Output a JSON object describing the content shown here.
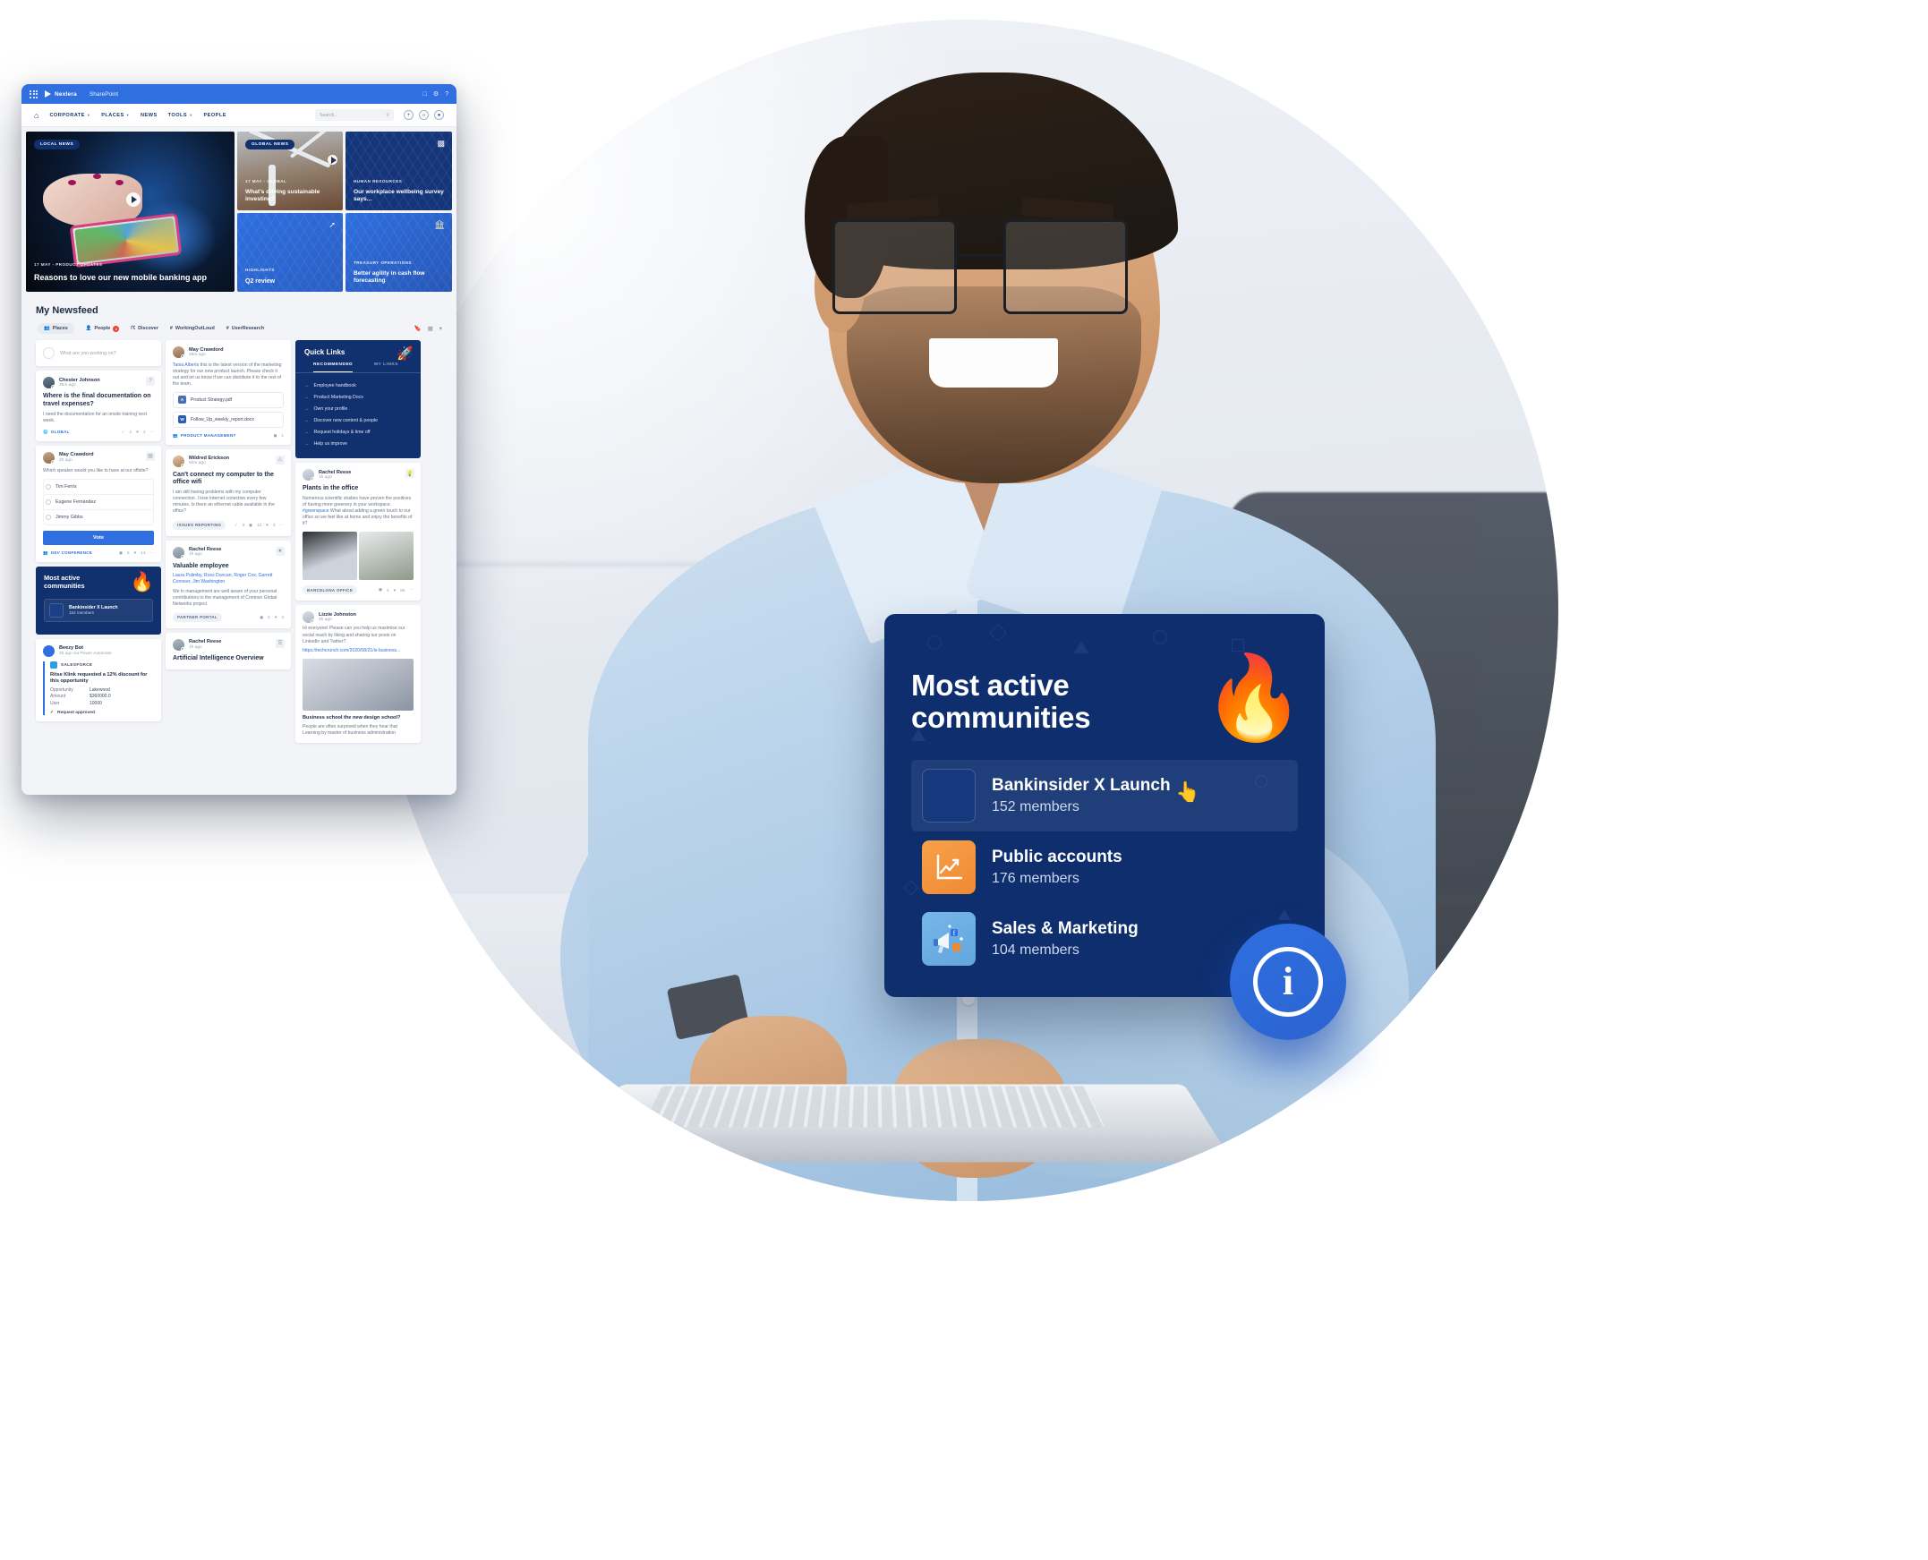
{
  "window": {
    "topbar": {
      "brand": "Nexlera",
      "app": "SharePoint",
      "waffle_icon": "app-launcher-icon",
      "actions": [
        "minimize-icon",
        "gear-icon",
        "help-icon"
      ]
    },
    "nav": {
      "home_icon": "home-icon",
      "items": [
        {
          "label": "CORPORATE",
          "caret": true
        },
        {
          "label": "PLACES",
          "caret": true
        },
        {
          "label": "NEWS",
          "caret": false
        },
        {
          "label": "TOOLS",
          "caret": true
        },
        {
          "label": "PEOPLE",
          "caret": false
        }
      ],
      "search_placeholder": "Search..",
      "search_icon": "search-icon",
      "icons": [
        "plus-icon",
        "bell-icon",
        "account-icon"
      ]
    }
  },
  "hero": {
    "local": {
      "badge": "LOCAL NEWS",
      "meta": "17 MAY - PRODUCT UPDATES",
      "title": "Reasons to love our new mobile banking app",
      "play_icon": "play-icon"
    },
    "global": {
      "badge": "GLOBAL NEWS",
      "meta": "17 MAY -  GLOBAL",
      "title": "What's driving sustainable investing?",
      "play_icon": "play-icon"
    },
    "hr": {
      "category": "HUMAN RESOURCES",
      "title": "Our workplace wellbeing survey says...",
      "icon": "bar-chart-icon"
    },
    "q2": {
      "category": "HIGHLIGHTS",
      "title": "Q2 review",
      "icon": "external-link-icon"
    },
    "treasury": {
      "category": "TREASURY OPERATIONS",
      "title": "Better agility in cash flow forecasting",
      "icon": "bank-icon"
    }
  },
  "newsfeed": {
    "title": "My Newsfeed",
    "filters": [
      {
        "label": "Places",
        "icon": "places-icon",
        "active": true,
        "badge": ""
      },
      {
        "label": "People",
        "icon": "people-icon",
        "active": false,
        "badge": "2"
      },
      {
        "label": "Discover",
        "icon": "discover-icon",
        "active": false,
        "badge": ""
      },
      {
        "label": "WorkingOutLoud",
        "icon": "hash-icon",
        "active": false,
        "badge": ""
      },
      {
        "label": "UserResearch",
        "icon": "hash-icon",
        "active": false,
        "badge": ""
      }
    ],
    "toolbar_icons": [
      "bookmark-icon",
      "calendar-icon",
      "filter-icon"
    ],
    "composer_placeholder": "What are you working on?"
  },
  "posts": {
    "chester": {
      "author": "Chester Johnson",
      "time": "35m ago",
      "title": "Where is the final documentation on travel expenses?",
      "body": "I need the documentation for an onsite training next week.",
      "tag": "GLOBAL",
      "tag_icon": "globe-icon",
      "card_icon": "question-icon",
      "stats": [
        {
          "icon": "answer-icon",
          "value": "2"
        },
        {
          "icon": "heart-icon",
          "value": "4"
        },
        {
          "icon": "more-icon",
          "value": ""
        }
      ]
    },
    "poll": {
      "author": "May Crawdord",
      "time": "2h ago",
      "question": "Which speaker would you like to have at our offsite?",
      "options": [
        "Tim Ferris",
        "Eugene Fernández",
        "Jimmy Gibbs"
      ],
      "vote_label": "Vote",
      "tag": "DEV CONFERENCE",
      "tag_icon": "people-icon",
      "card_icon": "poll-icon",
      "stats": [
        {
          "icon": "comment-icon",
          "value": "6"
        },
        {
          "icon": "heart-icon",
          "value": "14"
        },
        {
          "icon": "more-icon",
          "value": ""
        }
      ]
    },
    "may_share": {
      "author": "May Crawdord",
      "time": "49m ago",
      "body_mention": "Tania Alberts",
      "body": " this is the latest version of the marketing strategy for our new product launch. Please check it out and let us know if we can distribute it to the rest of the team.",
      "attachments": [
        {
          "name": "Product Strategy.pdf",
          "type": "pdf",
          "glyph": "A"
        },
        {
          "name": "Follow_Up_weekly_report.docx",
          "type": "doc",
          "glyph": "W"
        }
      ],
      "tag": "PRODUCT MANAGEMENT",
      "tag_icon": "people-icon",
      "stats": [
        {
          "icon": "comment-icon",
          "value": "1"
        },
        {
          "icon": "heart-icon",
          "value": "2"
        }
      ]
    },
    "mildred": {
      "author": "Mildred Erickson",
      "time": "50m ago",
      "title": "Can't connect my computer to the office wifi",
      "body": "I am still having problems with my computer connection. I lose internet conection every few minutes. Is there an ethernet cable available in the office?",
      "tag": "ISSUES REPORTING",
      "card_icon": "issue-icon",
      "stats": [
        {
          "icon": "answer-icon",
          "value": "3"
        },
        {
          "icon": "comment-icon",
          "value": "12"
        },
        {
          "icon": "heart-icon",
          "value": "3"
        },
        {
          "icon": "more-icon",
          "value": ""
        }
      ]
    },
    "rachel_valuable": {
      "author": "Rachel Reese",
      "time": "1h ago",
      "title": "Valuable employee",
      "mentions": "Laura Pulimby, Ross Duncan, Roger Cox, Garrett Conneer, Jim Washington",
      "body": "We in management are well aware of your personal contributions to the management of Contoso Global Networks project.",
      "tag": "PARTNER PORTAL",
      "card_icon": "badge-icon",
      "stats": [
        {
          "icon": "comment-icon",
          "value": "6"
        },
        {
          "icon": "heart-icon",
          "value": "2"
        }
      ]
    },
    "rachel_ai": {
      "author": "Rachel Reese",
      "time": "1h ago",
      "title": "Artificial Intelligence Overview",
      "card_icon": "doc-icon"
    },
    "rachel_plants": {
      "author": "Rachel Reese",
      "time": "1h ago",
      "title": "Plants in the office",
      "body_pre": "Numerous scientific studies have proven the positives of having more greenery in your workspace. ",
      "hashtag": "#greenspace",
      "body_post": " What about adding a green touch to our office so we feel like at home and enjoy the benefits of it?",
      "tag": "BARCELONA OFFICE",
      "card_icon": "idea-icon",
      "stats": [
        {
          "icon": "comment-icon",
          "value": "4"
        },
        {
          "icon": "heart-icon",
          "value": "85"
        },
        {
          "icon": "more-icon",
          "value": ""
        }
      ]
    },
    "lizzie": {
      "author": "Lizzie Johnston",
      "time": "4h ago",
      "body": "Hi everyone! Please can you help us maximise our social reach by liking and sharing our posts on LinkedIn and Twitter?",
      "link": "https://techcrunch.com/2020/08/21/is-business...",
      "caption": "Business school the new design school?",
      "sub": "People are often surprised when they hear that Learning by master of business administration"
    },
    "beezy_bot": {
      "author": "Beezy Bot",
      "time": "3h ago via Power Automate",
      "source": "SALESFORCE",
      "title": "Ritse Klink requested a 12% discount for this opportunity",
      "fields": [
        {
          "label": "Opportunity",
          "value": "Lakewood"
        },
        {
          "label": "Amount",
          "value": "$360000.0"
        },
        {
          "label": "User",
          "value": "10000"
        }
      ],
      "status": "Request approved",
      "status_icon": "check-icon"
    }
  },
  "most_active_small": {
    "title": "Most active communities",
    "flame_icon": "fire-icon",
    "rows": [
      {
        "name": "Bankinsider X Launch",
        "members": "152 members"
      }
    ]
  },
  "quick_links": {
    "title": "Quick Links",
    "rocket_icon": "rocket-icon",
    "tabs": [
      {
        "label": "RECOMMENDED",
        "active": true
      },
      {
        "label": "MY LINKS",
        "active": false
      }
    ],
    "links": [
      "Employee handbook",
      "Product Marketing Docs",
      "Own your profile",
      "Discover new content & people",
      "Request holidays & time off",
      "Help us improve"
    ],
    "arrow_icon": "arrow-right-icon"
  },
  "big_card": {
    "title_line1": "Most active",
    "title_line2": "communities",
    "flame_icon": "fire-icon",
    "cursor_icon": "hand-cursor-icon",
    "communities": [
      {
        "name": "Bankinsider X Launch",
        "members": "152 members",
        "icon": "empty-tile-icon",
        "selected": true
      },
      {
        "name": "Public accounts",
        "members": "176 members",
        "icon": "chart-up-icon",
        "selected": false
      },
      {
        "name": "Sales & Marketing",
        "members": "104 members",
        "icon": "megaphone-icon",
        "selected": false
      }
    ]
  },
  "info_fab": {
    "icon": "info-icon",
    "glyph": "i"
  },
  "colors": {
    "brand_blue": "#2f6fe0",
    "deep_navy": "#10306e",
    "card_navy": "#0e2e6e",
    "orange": "#f0913a",
    "light_blue": "#6fb1e5",
    "red_badge": "#e8412f"
  }
}
